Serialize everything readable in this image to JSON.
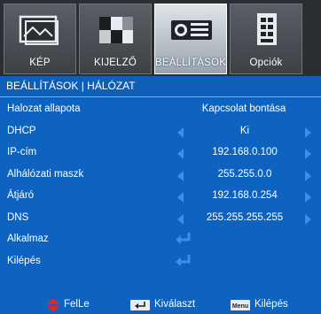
{
  "tabs": [
    {
      "label": "KÉP",
      "icon": "picture-icon"
    },
    {
      "label": "KIJELZŐ",
      "icon": "display-icon"
    },
    {
      "label": "BEÁLLÍTÁSOK",
      "icon": "projector-icon"
    },
    {
      "label": "Opciók",
      "icon": "options-icon"
    }
  ],
  "active_tab": "BEÁLLÍTÁSOK",
  "breadcrumb": "BEÁLLÍTÁSOK | HÁLÓZAT",
  "rows": {
    "status": {
      "label": "Halozat allapota",
      "value": "Kapcsolat bontása"
    },
    "dhcp": {
      "label": "DHCP",
      "value": "Ki"
    },
    "ip": {
      "label": "IP-cím",
      "value": "192.168.0.100"
    },
    "subnet": {
      "label": "Alhálózati maszk",
      "value": "255.255.0.0"
    },
    "gateway": {
      "label": "Átjáró",
      "value": "192.168.0.254"
    },
    "dns": {
      "label": "DNS",
      "value": "255.255.255.255"
    },
    "apply": {
      "label": "Alkalmaz"
    },
    "exit": {
      "label": "Kilépés"
    }
  },
  "footer": {
    "up_label": "FelLe",
    "select_label": "Kiválaszt",
    "menu_key": "Menu",
    "exit_label": "Kilépés"
  },
  "colors": {
    "background": "#0d63bf",
    "arrow": "#3d8cf0",
    "footer_up_arrow": "#e8232b"
  }
}
